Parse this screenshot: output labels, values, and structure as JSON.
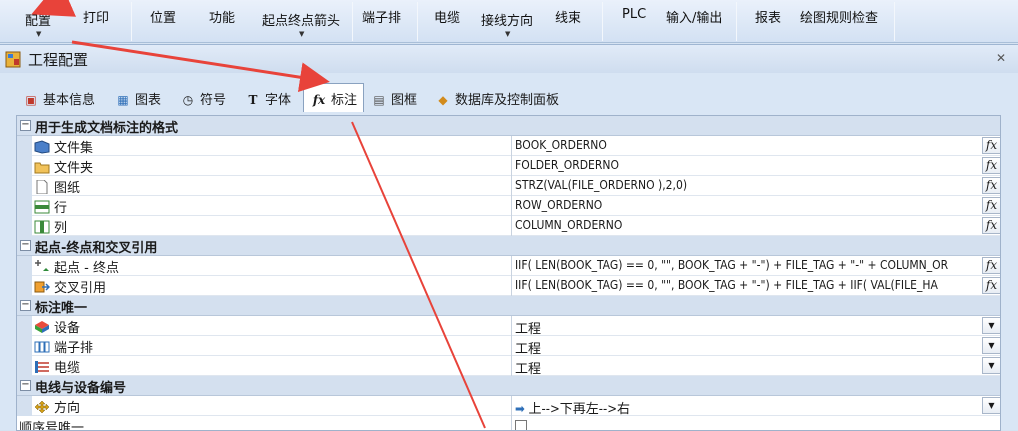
{
  "ribbon": {
    "config": "配置",
    "print": "打印",
    "position": "位置",
    "function": "功能",
    "start_end_arrow": "起点终点箭头",
    "terminal_strip": "端子排",
    "cable": "电缆",
    "wire_direction": "接线方向",
    "wire_bundle": "线束",
    "plc": "PLC",
    "io": "输入/输出",
    "report": "报表",
    "drawing_check": "绘图规则检查"
  },
  "dialog": {
    "title": "工程配置",
    "close": "✕"
  },
  "tabs": [
    {
      "label": "基本信息"
    },
    {
      "label": "图表"
    },
    {
      "label": "符号"
    },
    {
      "label": "字体"
    },
    {
      "label": "标注",
      "icon_text": "fx"
    },
    {
      "label": "图框"
    },
    {
      "label": "数据库及控制面板"
    }
  ],
  "grid": {
    "cat1": {
      "label": "用于生成文档标注的格式",
      "toggle": "−",
      "rows": [
        {
          "name": "文件集",
          "value": "BOOK_ORDERNO"
        },
        {
          "name": "文件夹",
          "value": "FOLDER_ORDERNO"
        },
        {
          "name": "图纸",
          "value": "STRZ(VAL(FILE_ORDERNO ),2,0)"
        },
        {
          "name": "行",
          "value": "ROW_ORDERNO"
        },
        {
          "name": "列",
          "value": "COLUMN_ORDERNO"
        }
      ]
    },
    "cat2": {
      "label": "起点-终点和交叉引用",
      "toggle": "−",
      "rows": [
        {
          "name": "起点 - 终点",
          "value": "IIF( LEN(BOOK_TAG) == 0, \"\", BOOK_TAG + \"-\") + FILE_TAG + \"-\" + COLUMN_OR"
        },
        {
          "name": "交叉引用",
          "value": "IIF( LEN(BOOK_TAG) == 0, \"\", BOOK_TAG + \"-\") + FILE_TAG + IIF( VAL(FILE_HA"
        }
      ]
    },
    "cat3": {
      "label": "标注唯一",
      "toggle": "−",
      "rows": [
        {
          "name": "设备",
          "value": "工程"
        },
        {
          "name": "端子排",
          "value": "工程"
        },
        {
          "name": "电缆",
          "value": "工程"
        }
      ]
    },
    "cat4": {
      "label": "电线与设备编号",
      "toggle": "−",
      "rows": [
        {
          "name": "方向",
          "value": "上-->下再左-->右"
        },
        {
          "name": "顺序号唯一",
          "value": ""
        }
      ]
    },
    "fx_label": "fx",
    "dd_label": "▼"
  },
  "colors": {
    "annotation_arrow": "#e8433a",
    "accent": "#d4e0ef"
  }
}
